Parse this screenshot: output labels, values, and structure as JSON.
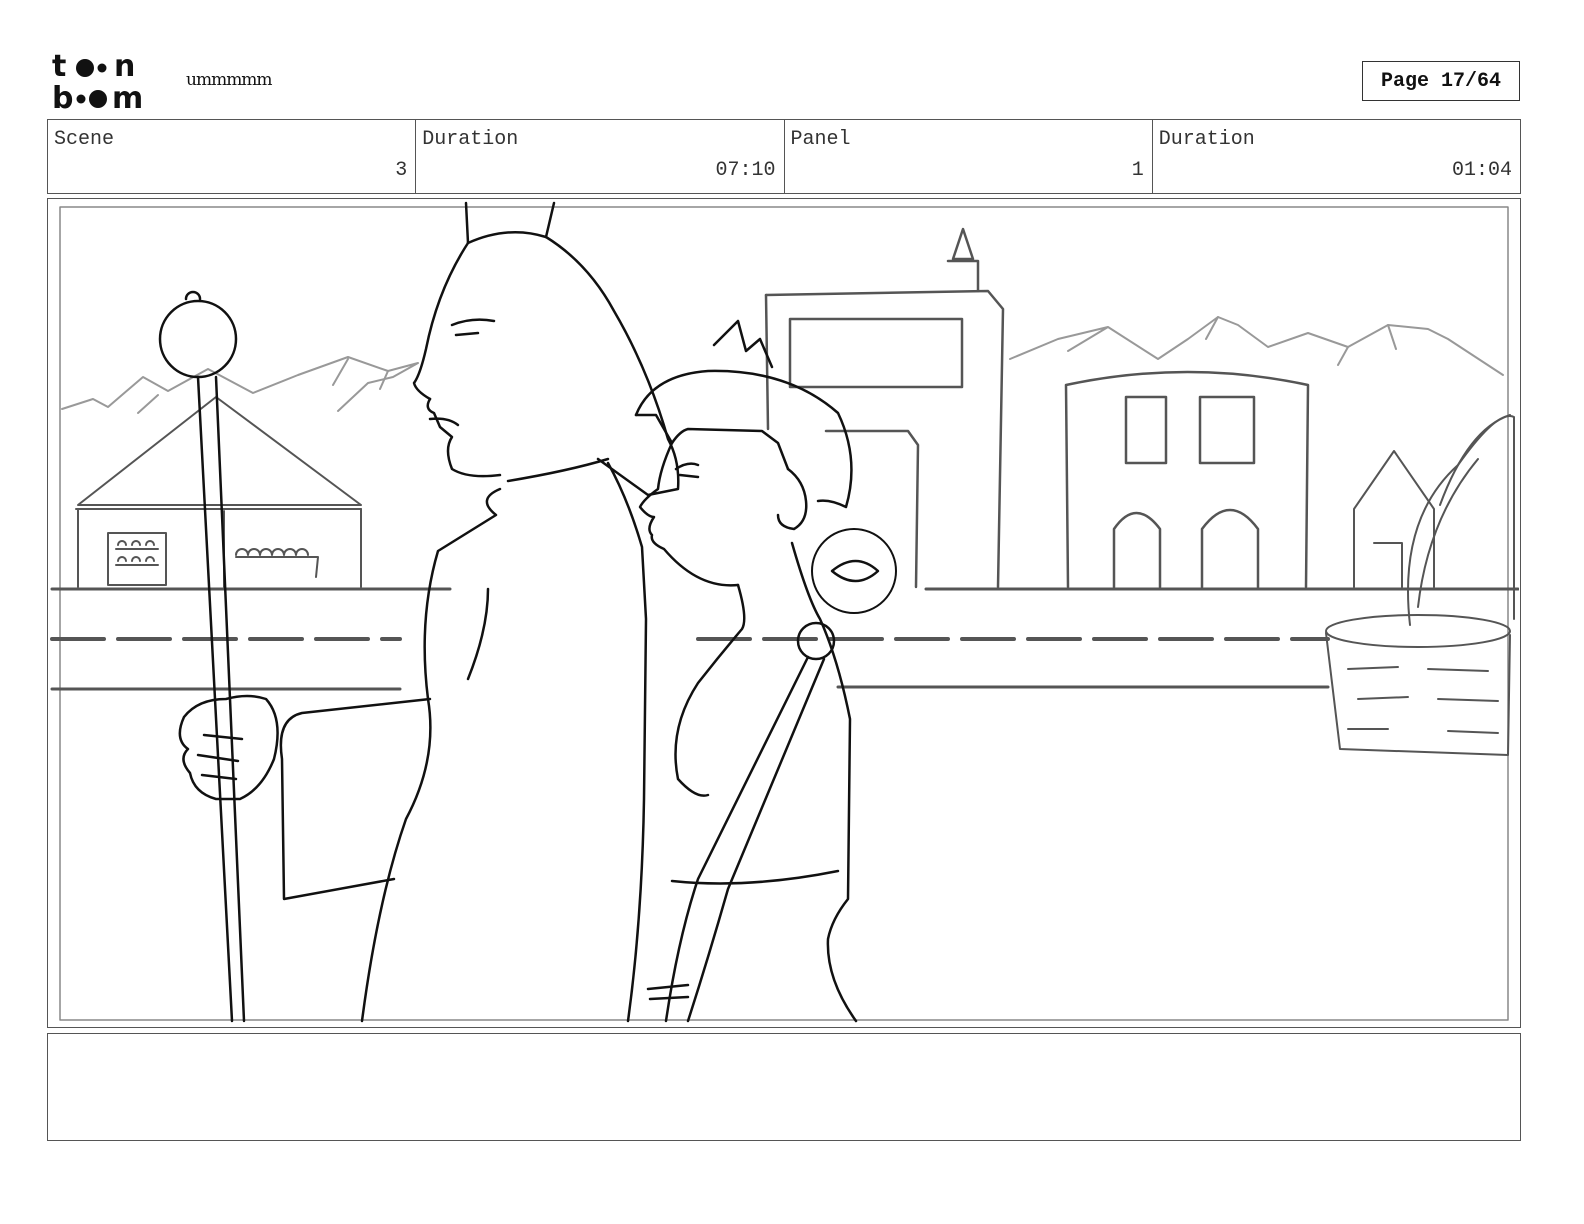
{
  "header": {
    "logo_lines": [
      "toon",
      "boom"
    ],
    "logo_icon": "toon-boom-logo",
    "project_name": "ummmmm",
    "page_label": "Page 17/64"
  },
  "info": {
    "scene_label": "Scene",
    "scene_value": "3",
    "scene_duration_label": "Duration",
    "scene_duration_value": "07:10",
    "panel_label": "Panel",
    "panel_value": "1",
    "panel_duration_label": "Duration",
    "panel_duration_value": "01:04"
  },
  "notes": {
    "text": ""
  },
  "colors": {
    "ink": "#111111",
    "background_lines": "#666666",
    "mountains": "#999999",
    "frame": "#555555"
  }
}
